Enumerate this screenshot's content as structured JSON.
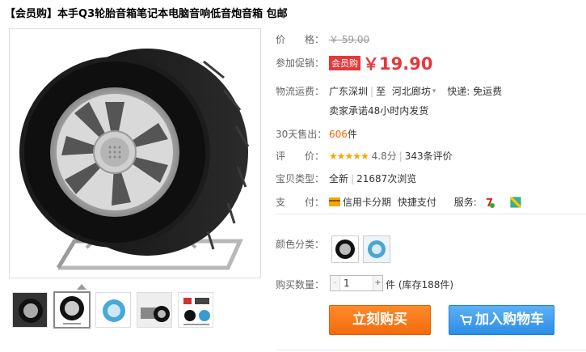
{
  "title": {
    "tag": "【会员购】",
    "text": "本手Q3轮胎音箱笔记本电脑音响低音炮音箱 包邮"
  },
  "price": {
    "label": "价　　格：",
    "original": "￥ 59.00"
  },
  "promo": {
    "label": "参加促销：",
    "badge": "会员购",
    "yen": "￥",
    "price": "19.90"
  },
  "shipping": {
    "label": "物流运费：",
    "from": "广东深圳",
    "to_prefix": "至",
    "to": "河北廊坊",
    "express": "快递: 免运费",
    "promise": "卖家承诺48小时内发货"
  },
  "sales": {
    "label": "30天售出：",
    "count": "606",
    "unit": "件"
  },
  "rating": {
    "label": "评　　价：",
    "stars": "★★★★★",
    "score": "4.8分",
    "reviews": "343条评价"
  },
  "item_type": {
    "label": "宝贝类型：",
    "value": "全新",
    "views": "21687次浏览"
  },
  "payment": {
    "label": "支　　付：",
    "credit": "信用卡分期",
    "quick": "快捷支付",
    "service_label": "服务:"
  },
  "color": {
    "label": "颜色分类："
  },
  "quantity": {
    "label": "购买数量：",
    "minus": "-",
    "value": "1",
    "plus": "+",
    "unit": "件",
    "stock": "(库存188件)"
  },
  "buttons": {
    "buy": "立刻购买",
    "cart": "加入购物车"
  },
  "colors": {
    "accent_red": "#e4393c",
    "orange": "#f36b0b",
    "blue": "#2b8ee6",
    "star": "#f7a600"
  },
  "icons": [
    "chevron-down-icon",
    "credit-card-icon",
    "seven-day-return-icon",
    "guarantee-icon",
    "cart-icon"
  ]
}
